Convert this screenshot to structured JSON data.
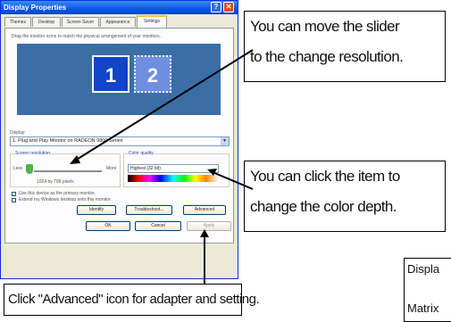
{
  "dialog": {
    "title": "Display Properties",
    "help_glyph": "?",
    "close_glyph": "✕",
    "tabs": [
      "Themes",
      "Desktop",
      "Screen Saver",
      "Appearance",
      "Settings"
    ],
    "active_tab": "Settings",
    "instruction": "Drag the monitor icons to match the physical arrangement of your monitors.",
    "monitors": [
      "1",
      "2"
    ],
    "display_label": "Display:",
    "display_value": "1. Plug and Play Monitor on RADEON 9800 Series",
    "screen_resolution": {
      "label": "Screen resolution",
      "less": "Less",
      "more": "More",
      "value": "1024 by 768 pixels",
      "slider_level": 0.0
    },
    "color_quality": {
      "label": "Color quality",
      "value": "Highest (32 bit)"
    },
    "checkboxes": [
      "Use this device as the primary monitor.",
      "Extend my Windows desktop onto this monitor."
    ],
    "buttons": {
      "identify": "Identify",
      "troubleshoot": "Troubleshoot...",
      "advanced": "Advanced",
      "ok": "OK",
      "cancel": "Cancel",
      "apply": "Apply"
    }
  },
  "callouts": {
    "resolution": [
      "You can move the slider",
      "to the change resolution."
    ],
    "color": [
      "You can click the item to",
      "change the color depth."
    ],
    "advanced": "Click \"Advanced\" icon for adapter and setting.",
    "partial": [
      "Displa",
      "Matrix"
    ]
  }
}
